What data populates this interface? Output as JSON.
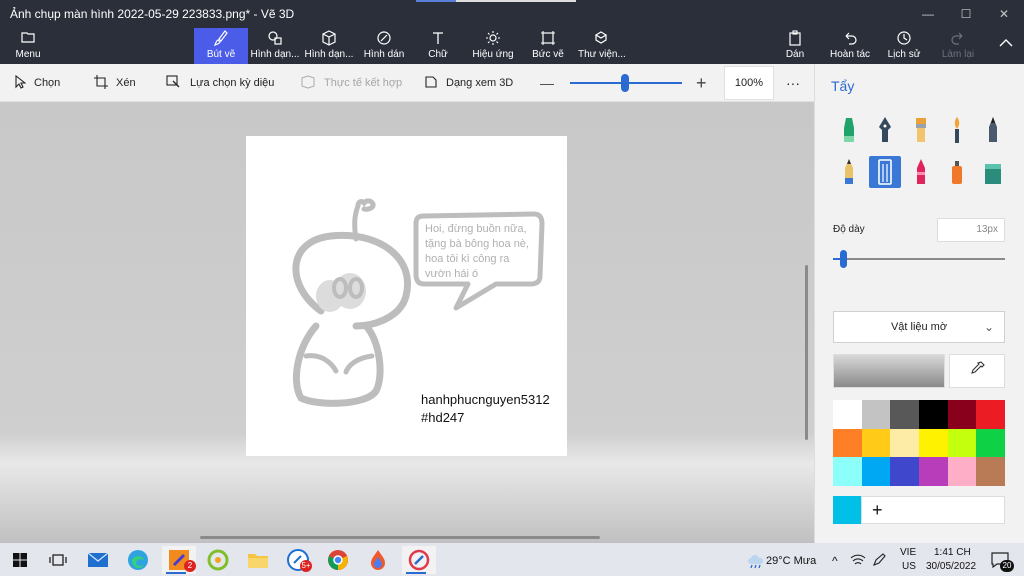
{
  "window": {
    "title": "Ảnh chụp màn hình 2022-05-29 223833.png* - Vẽ 3D",
    "controls": {
      "minimize": "—",
      "maximize": "☐",
      "close": "✕"
    }
  },
  "ribbon": {
    "menu": "Menu",
    "tabs": [
      "Bút vẽ",
      "Hình dạn...",
      "Hình dạn...",
      "Hình dán",
      "Chữ",
      "Hiệu ứng",
      "Bức vẽ",
      "Thư viện..."
    ],
    "right": {
      "paste": "Dán",
      "undo": "Hoàn tác",
      "history": "Lịch sử",
      "redo": "Làm lại"
    }
  },
  "toolbar": {
    "select": "Chọn",
    "crop": "Xén",
    "magic_select": "Lựa chọn kỳ diệu",
    "mixed_reality": "Thực tế kết hợp",
    "view_3d": "Dạng xem 3D",
    "zoom_minus": "—",
    "zoom_plus": "+",
    "zoom": "100%",
    "more": "···"
  },
  "canvas": {
    "speech_lines": [
      "Hoi, đừng buồn nữa,",
      "tặng bà bông hoa nè,",
      "hoa tôi kì công ra",
      "vườn hái ó"
    ],
    "signature_1": "hanhphucnguyen5312",
    "signature_2": "#hd247"
  },
  "panel": {
    "title": "Tẩy",
    "thickness_label": "Độ dày",
    "thickness_value": "13px",
    "thickness_level": 0.04,
    "material": "Vật liệu mờ",
    "brushes": [
      "marker-icon",
      "calligraphy-pen-icon",
      "oil-brush-icon",
      "watercolor-icon",
      "pixel-pen-icon",
      "pencil-icon",
      "eraser-icon",
      "crayon-icon",
      "spray-can-icon",
      "fill-icon"
    ],
    "palette": [
      "#ffffff",
      "#c3c3c3",
      "#585858",
      "#000000",
      "#88001b",
      "#ec1c24",
      "#ff7f27",
      "#ffca18",
      "#fdeca6",
      "#fff200",
      "#c4ff0e",
      "#0ed145",
      "#8cfffb",
      "#00a8f3",
      "#3f48cc",
      "#b83dba",
      "#ffaec8",
      "#b97a56"
    ],
    "custom_color": "#00c0e8",
    "add": "+"
  },
  "taskbar": {
    "weather": "29°C  Mưa",
    "lang_1": "VIE",
    "lang_2": "US",
    "time": "1:41 CH",
    "date": "30/05/2022",
    "notifications": "20",
    "badges": {
      "paint": "2",
      "chrome": "5+"
    }
  }
}
